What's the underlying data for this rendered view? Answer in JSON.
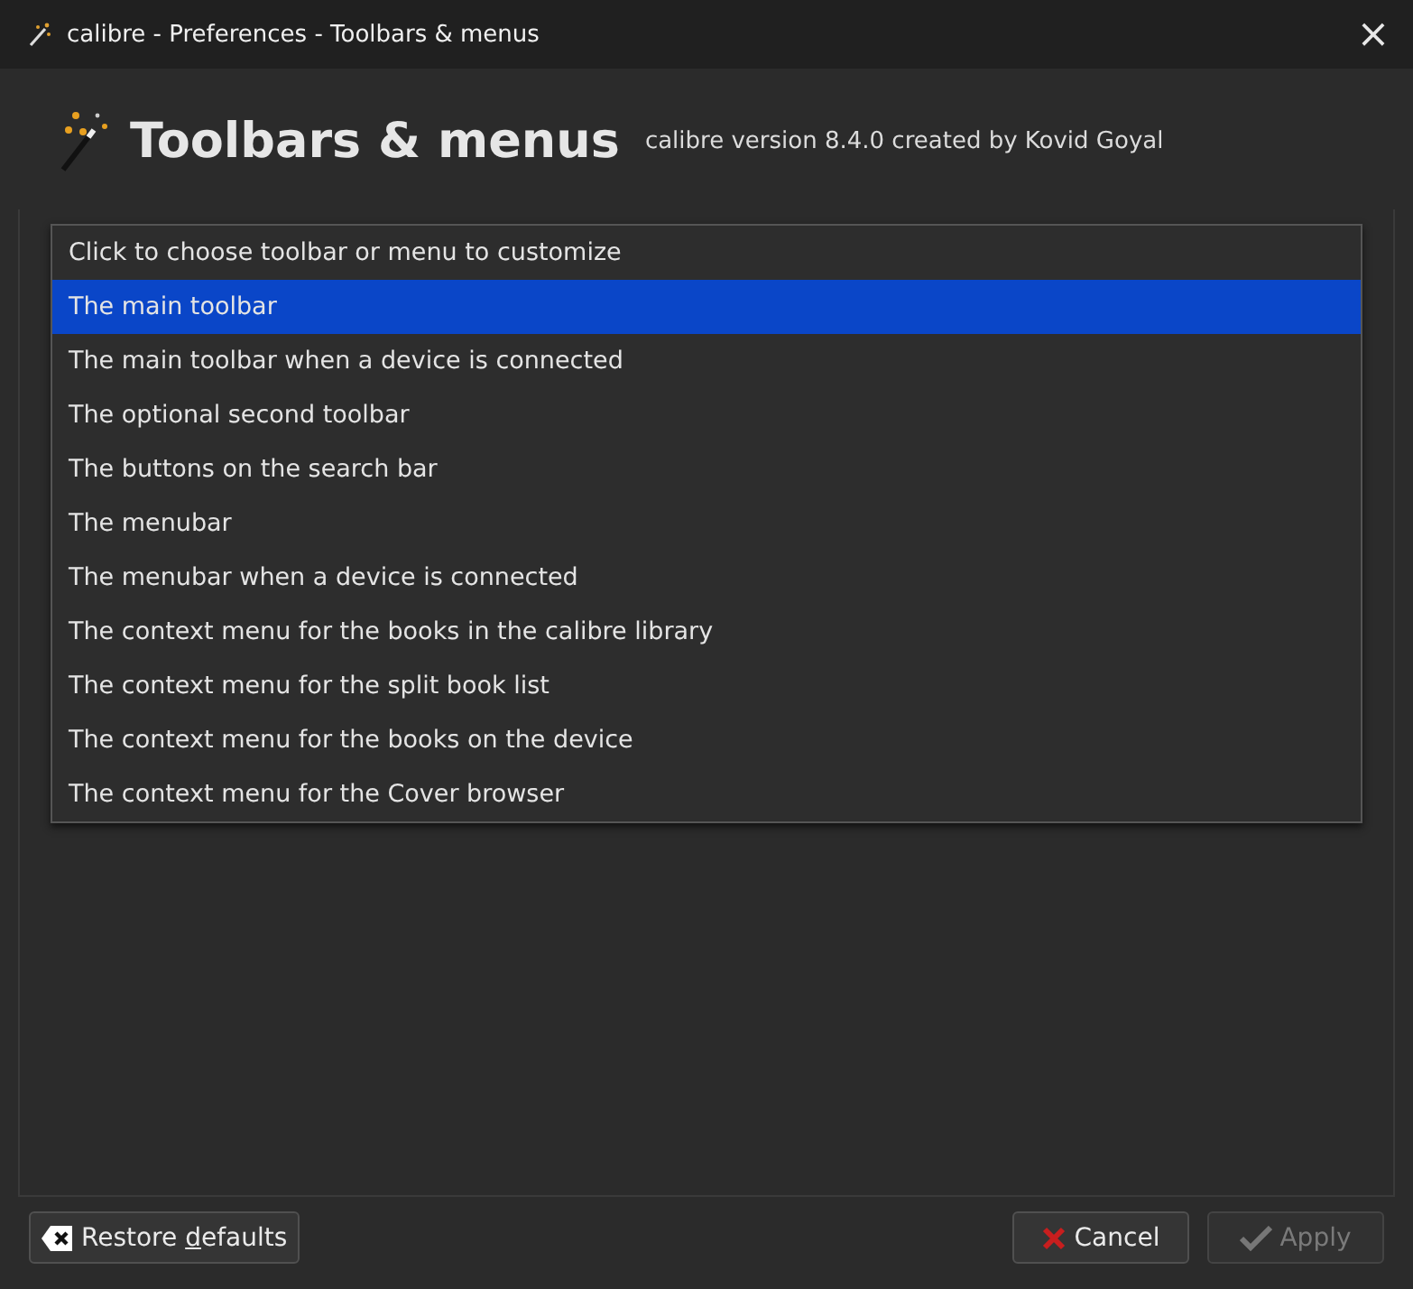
{
  "window": {
    "title": "calibre - Preferences - Toolbars & menus",
    "close": "×"
  },
  "header": {
    "title": "Toolbars & menus",
    "subtitle": "calibre version 8.4.0 created by Kovid Goyal"
  },
  "dropdown": {
    "items": [
      {
        "label": "Click to choose toolbar or menu to customize",
        "selected": false
      },
      {
        "label": "The main toolbar",
        "selected": true
      },
      {
        "label": "The main toolbar when a device is connected",
        "selected": false
      },
      {
        "label": "The optional second toolbar",
        "selected": false
      },
      {
        "label": "The buttons on the search bar",
        "selected": false
      },
      {
        "label": "The menubar",
        "selected": false
      },
      {
        "label": "The menubar when a device is connected",
        "selected": false
      },
      {
        "label": "The context menu for the books in the calibre library",
        "selected": false
      },
      {
        "label": "The context menu for the split book list",
        "selected": false
      },
      {
        "label": "The context menu for the books on the device",
        "selected": false
      },
      {
        "label": "The context menu for the Cover browser",
        "selected": false
      }
    ]
  },
  "buttons": [
    {
      "kind": "restore",
      "label_before": "Restore ",
      "mnemonic": "d",
      "label_after": "efaults",
      "disabled": false
    },
    {
      "kind": "cancel",
      "label_before": "Cancel",
      "disabled": false
    },
    {
      "kind": "apply",
      "label_before": "Apply",
      "disabled": true
    }
  ]
}
